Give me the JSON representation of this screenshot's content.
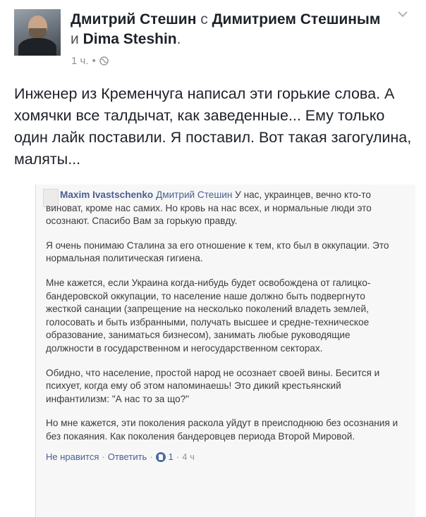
{
  "post": {
    "author": "Дмитрий Стешин",
    "with_word": "с",
    "tagged_1": "Димитрием Стешиным",
    "and_word": "и",
    "tagged_2": "Dima Steshin",
    "period": ".",
    "time": "1 ч.",
    "dot": "•",
    "text": "Инженер из Кременчуга написал эти горькие слова. А хомячки все талдычат, как заведенные... Ему только один лайк поставили. Я поставил. Вот такая загогулина, маляты..."
  },
  "comment": {
    "author": "Maxim Ivastschenko",
    "mention": "Дмитрий Стешин",
    "paragraphs": [
      "У нас, украинцев, вечно кто-то виноват, кроме нас самих. Но кровь на нас всех, и нормальные люди это осознают. Спасибо Вам за горькую правду.",
      "Я очень понимаю Сталина за его отношение к тем, кто был в оккупации. Это нормальная политическая гигиена.",
      "Мне кажется, если Украина когда-нибудь будет освобождена от галицко-бандеровской оккупации, то население наше должно быть подвергнуто жесткой санации (запрещение на несколько поколений владеть землей, голосовать и быть избранными, получать высшее и средне-техническое образование, заниматься бизнесом), занимать любые руководящие должности в государственном и негосударственном секторах.",
      "Обидно, что население, простой народ не осознает своей вины. Бесится и психует, когда ему об этом напоминаешь! Это дикий крестьянский инфантилизм: \"А нас то за що?\"",
      "Но мне кажется, эти поколения раскола уйдут в преисподнюю без осознания и без покаяния. Как поколения бандеровцев периода Второй Мировой."
    ],
    "like_label": "Не нравится",
    "reply_label": "Ответить",
    "like_count": "1",
    "time": "4 ч",
    "sep": "·"
  },
  "icons": {
    "globe": "globe-icon",
    "chevron": "chevron-down-icon",
    "like": "like-icon"
  },
  "colors": {
    "link": "#4a5f91",
    "text": "#1d2129",
    "meta": "#90949c"
  }
}
